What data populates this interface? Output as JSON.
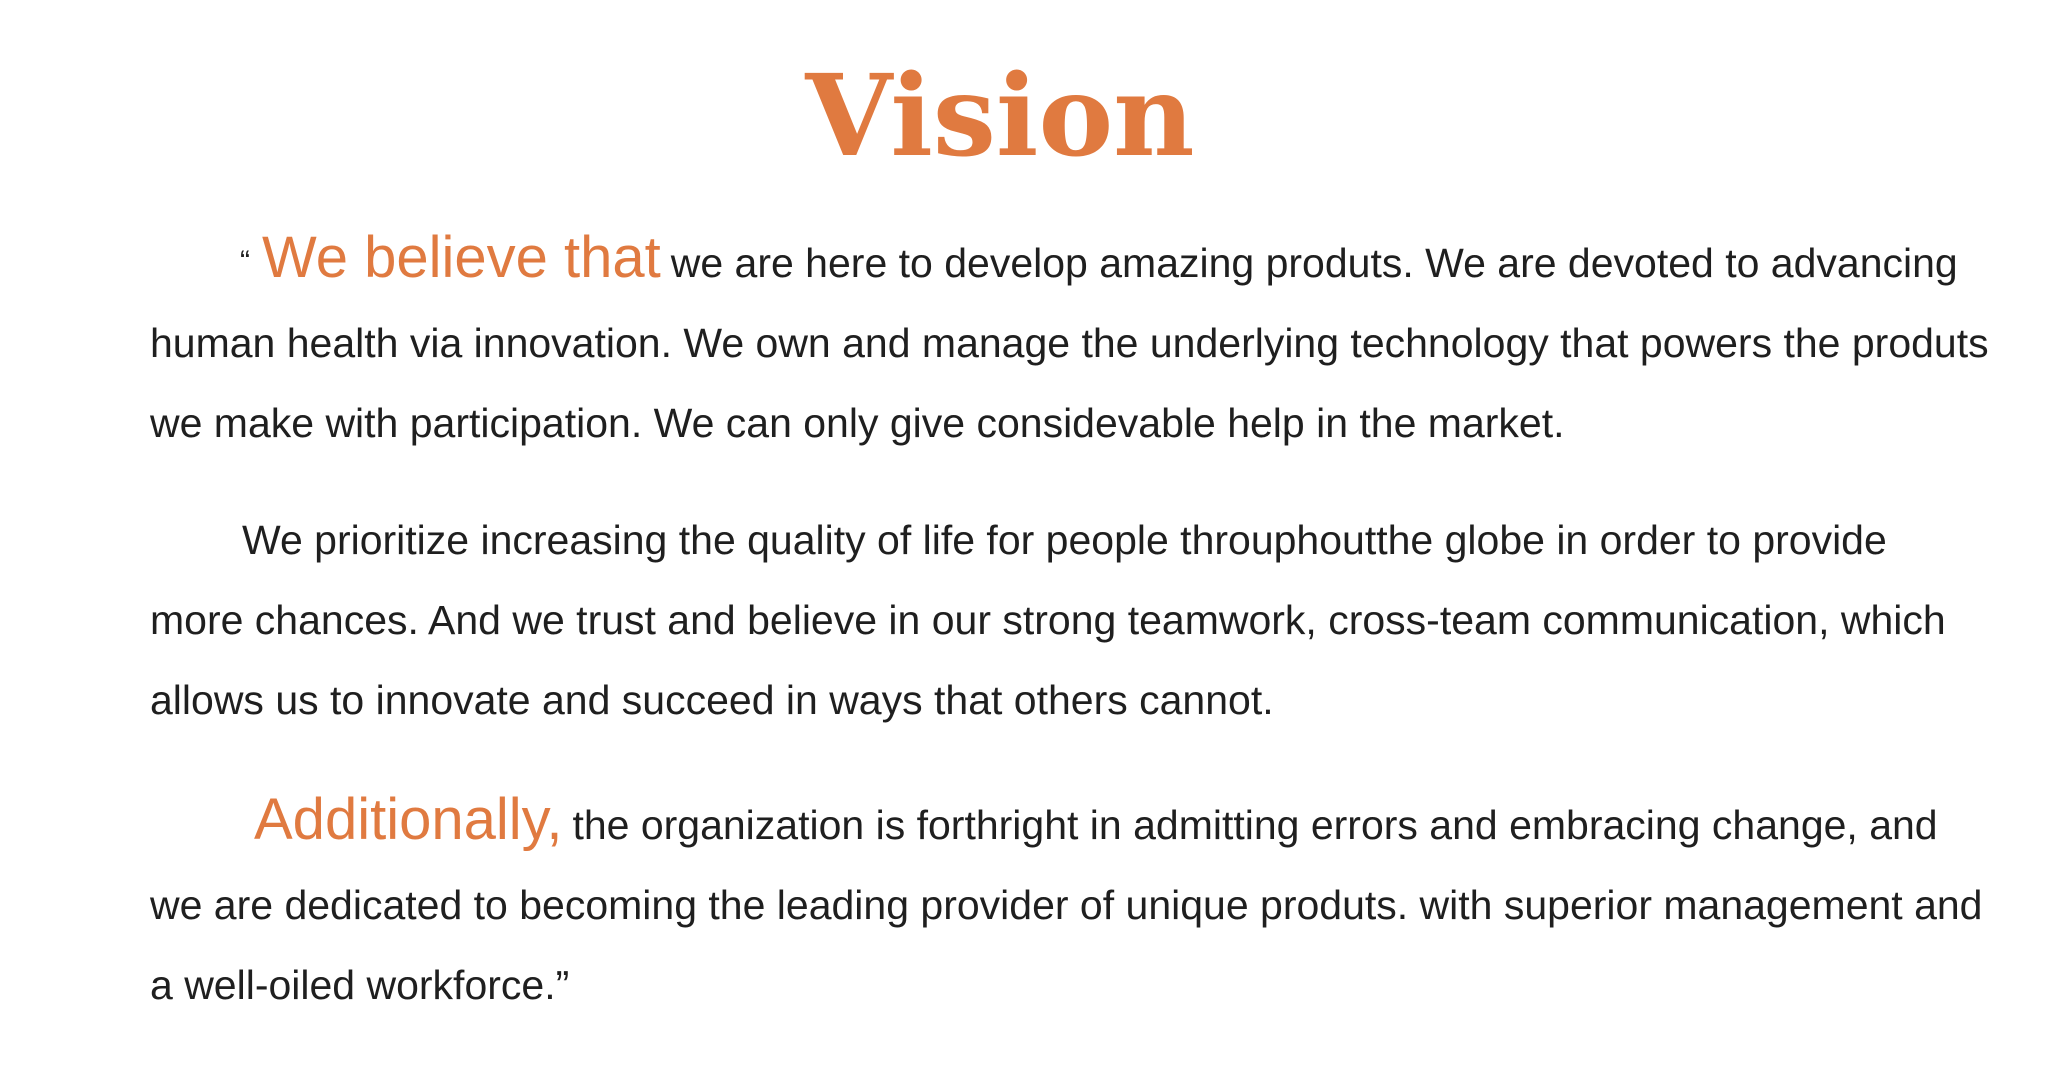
{
  "title": "Vision",
  "paragraph1": {
    "open_quote": "“",
    "lead": "We believe that",
    "text": "we are here to develop amazing produts. We are devoted to advancing human health via innovation. We own and manage the underlying technology that powers the produts we make with participation. We can only give considevable help in the market."
  },
  "paragraph2": {
    "text": "We prioritize increasing the quality of life for people throuphoutthe globe in order to provide more chances. And we trust and believe in our strong teamwork, cross-team communication, which allows us to innovate and succeed in ways that others cannot."
  },
  "paragraph3": {
    "lead": "Additionally,",
    "text": "the organization is forthright in admitting errors and embracing change, and we are dedicated to becoming the leading provider of unique produts. with superior management and a well-oiled workforce.”"
  },
  "colors": {
    "accent": "#e07a40",
    "text": "#1f1f1f",
    "background": "#ffffff"
  }
}
